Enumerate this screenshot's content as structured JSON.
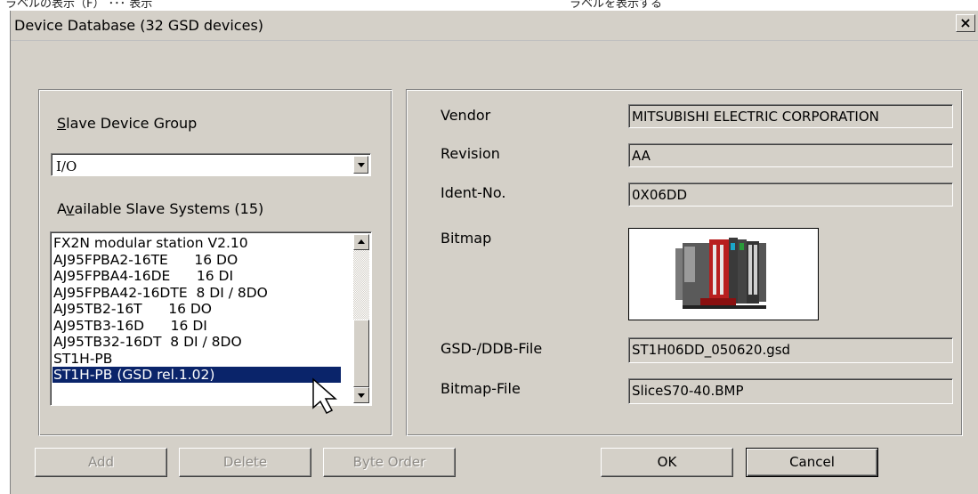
{
  "top_strip": {
    "left_text": "ラベルの表示（F）  ･･･ 表示",
    "right_text": "ラベルを表示する"
  },
  "dialog": {
    "title": "Device Database (32 GSD devices)",
    "close_label": "×"
  },
  "left_panel": {
    "group_label": "Slave Device Group",
    "group_value": "I/O",
    "available_label": "Available Slave Systems (15)",
    "slaves": [
      "FX2N modular station V2.10",
      "AJ95FPBA2-16TE      16 DO",
      "AJ95FPBA4-16DE      16 DI",
      "AJ95FPBA42-16DTE  8 DI / 8DO",
      "AJ95TB2-16T      16 DO",
      "AJ95TB3-16D      16 DI",
      "AJ95TB32-16DT  8 DI / 8DO",
      "ST1H-PB",
      "ST1H-PB (GSD rel.1.02)"
    ],
    "selected_index": 8
  },
  "right_panel": {
    "vendor_label": "Vendor",
    "vendor_value": "MITSUBISHI ELECTRIC CORPORATION",
    "revision_label": "Revision",
    "revision_value": "AA",
    "ident_label": "Ident-No.",
    "ident_value": "0X06DD",
    "bitmap_label": "Bitmap",
    "gsd_label": "GSD-/DDB-File",
    "gsd_value": "ST1H06DD_050620.gsd",
    "bitmap_file_label": "Bitmap-File",
    "bitmap_file_value": "SliceS70-40.BMP"
  },
  "buttons": {
    "add": "Add",
    "delete": "Delete",
    "byte_order": "Byte Order",
    "ok": "OK",
    "cancel": "Cancel"
  },
  "icons": {
    "close": "close-icon",
    "dropdown": "chevron-down-icon",
    "scroll_up": "scroll-up-arrow",
    "scroll_down": "scroll-down-arrow",
    "device_image": "plc-module-icon",
    "cursor": "mouse-pointer-icon"
  }
}
